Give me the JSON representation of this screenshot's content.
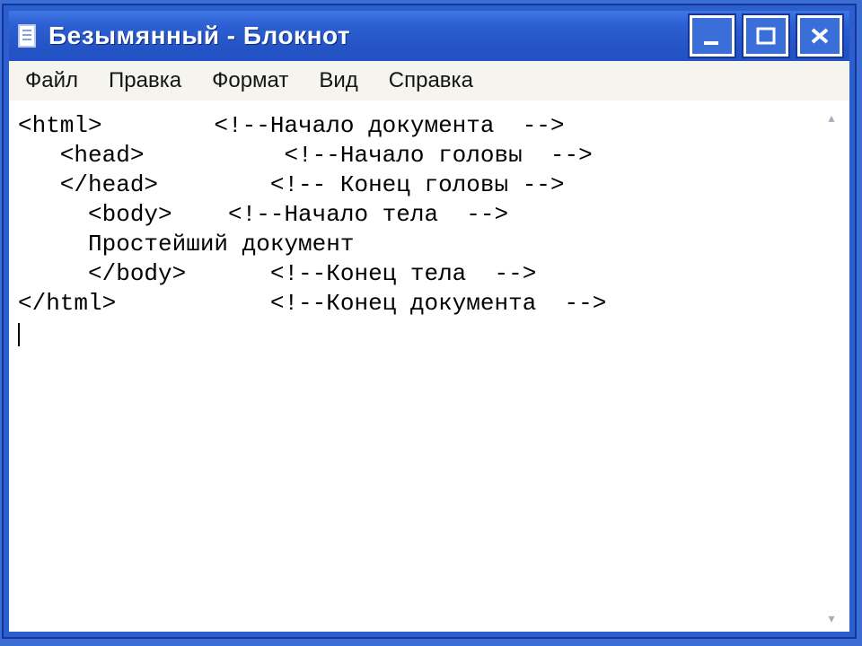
{
  "window": {
    "title": "Безымянный - Блокнот"
  },
  "menu": {
    "file": "Файл",
    "edit": "Правка",
    "format": "Формат",
    "view": "Вид",
    "help": "Справка"
  },
  "editor": {
    "lines": [
      "<html>        <!--Начало документа  -->",
      "   <head>          <!--Начало головы  -->",
      "   </head>        <!-- Конец головы -->",
      "     <body>    <!--Начало тела  -->",
      "     Простейший документ",
      "     </body>      <!--Конец тела  -->",
      "</html>           <!--Конец документа  -->"
    ]
  }
}
